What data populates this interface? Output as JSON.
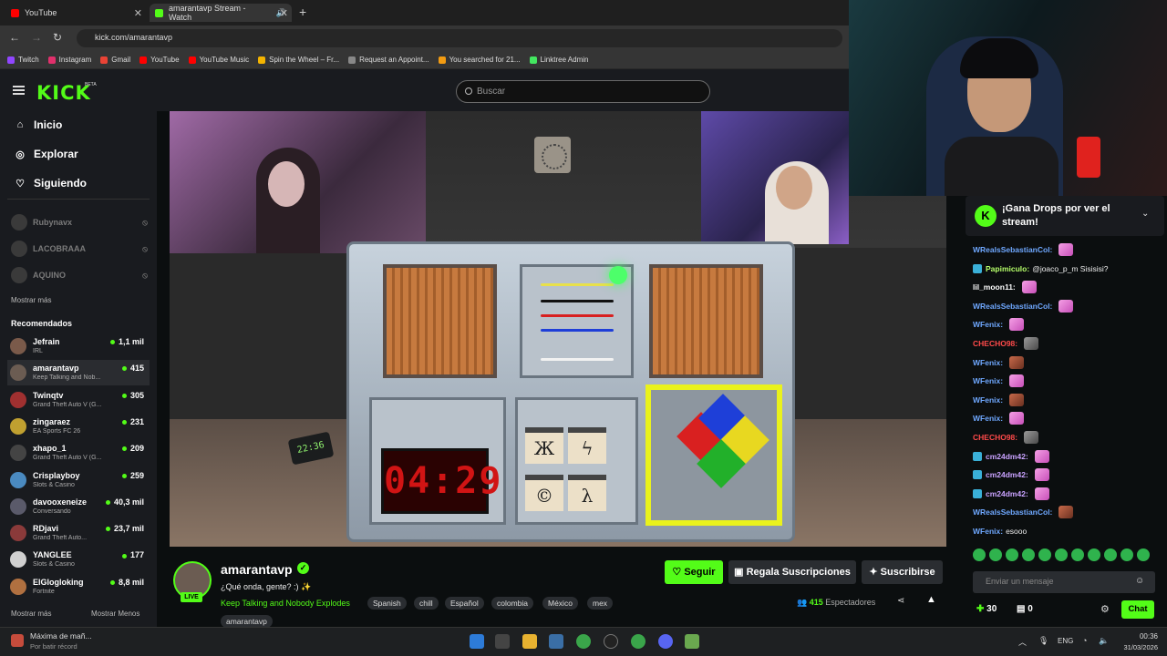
{
  "browser": {
    "tabs": [
      {
        "label": "YouTube",
        "color": "#ff0000"
      },
      {
        "label": "amarantavp Stream - Watch",
        "color": "#53fc18"
      }
    ],
    "url": "kick.com/amarantavp",
    "bookmarks": [
      {
        "label": "Twitch",
        "color": "#9146ff"
      },
      {
        "label": "Instagram",
        "color": "#e1306c"
      },
      {
        "label": "Gmail",
        "color": "#ea4335"
      },
      {
        "label": "YouTube",
        "color": "#ff0000"
      },
      {
        "label": "YouTube Music",
        "color": "#ff0000"
      },
      {
        "label": "Spin the Wheel – Fr...",
        "color": "#f4b400"
      },
      {
        "label": "Request an Appoint...",
        "color": "#888888"
      },
      {
        "label": "You searched for 21...",
        "color": "#f39c12"
      },
      {
        "label": "Linktree Admin",
        "color": "#43e660"
      }
    ]
  },
  "header": {
    "logo": "KICK",
    "beta": "BETA",
    "search_placeholder": "Buscar"
  },
  "sidebar": {
    "nav": [
      {
        "label": "Inicio",
        "icon": "home-icon"
      },
      {
        "label": "Explorar",
        "icon": "compass-icon"
      },
      {
        "label": "Siguiendo",
        "icon": "heart-icon"
      }
    ],
    "offline": [
      "Rubynavx",
      "LACOBRAAA",
      "AQUINO"
    ],
    "show_more": "Mostrar más",
    "recommended_title": "Recomendados",
    "recommended": [
      {
        "name": "Jefrain",
        "category": "IRL",
        "viewers": "1,1 mil",
        "color": "#7a5a4a"
      },
      {
        "name": "amarantavp",
        "category": "Keep Talking and Nob...",
        "viewers": "415",
        "color": "#6b5c52"
      },
      {
        "name": "Twinqtv",
        "category": "Grand Theft Auto V (G...",
        "viewers": "305",
        "color": "#a03030"
      },
      {
        "name": "zingaraez",
        "category": "EA Sports FC 26",
        "viewers": "231",
        "color": "#c0a030"
      },
      {
        "name": "xhapo_1",
        "category": "Grand Theft Auto V (G...",
        "viewers": "209",
        "color": "#444444"
      },
      {
        "name": "Crisplayboy",
        "category": "Slots & Casino",
        "viewers": "259",
        "color": "#4a8ac0"
      },
      {
        "name": "davooxeneize",
        "category": "Conversando",
        "viewers": "40,3 mil",
        "color": "#5a5a6a"
      },
      {
        "name": "RDjavi",
        "category": "Grand Theft Auto...",
        "viewers": "23,7 mil",
        "color": "#8a3a3a"
      },
      {
        "name": "YANGLEE",
        "category": "Slots & Casino",
        "viewers": "177",
        "color": "#d0d0d0"
      },
      {
        "name": "ElGlogloking",
        "category": "Fortnite",
        "viewers": "8,8 mil",
        "color": "#b07040"
      }
    ],
    "show_more_bottom": "Mostrar más",
    "show_less": "Mostrar Menos"
  },
  "game": {
    "timer": "04:29",
    "clock": "22:36",
    "symbols": [
      "Ж",
      "ϟ",
      "©",
      "λ"
    ]
  },
  "stream": {
    "channel": "amarantavp",
    "live": "LIVE",
    "title": "¿Qué onda, gente? :) ✨",
    "game": "Keep Talking and Nobody Explodes",
    "tags": [
      "Spanish",
      "chill",
      "Español",
      "colombia",
      "México",
      "mex",
      "amarantavp"
    ],
    "follow": "Seguir",
    "gift": "Regala Suscripciones",
    "subscribe": "Suscribirse",
    "viewers": "415",
    "viewers_label": "Espectadores"
  },
  "chat": {
    "drops_text": "¡Gana Drops por ver el stream!",
    "messages": [
      {
        "user": "WRealsSebastianCol:",
        "text": "",
        "color": "#6fa8ff",
        "emote": "hand",
        "badge": false
      },
      {
        "user": "Papimiculo:",
        "text": "@joaco_p_m Sisisisi?",
        "color": "#b6ff6a",
        "emote": "",
        "badge": true
      },
      {
        "user": "lil_moon11:",
        "text": "",
        "color": "#ffffff",
        "emote": "hand",
        "badge": false
      },
      {
        "user": "WRealsSebastianCol:",
        "text": "",
        "color": "#6fa8ff",
        "emote": "hand",
        "badge": false
      },
      {
        "user": "WFenix:",
        "text": "",
        "color": "#6fa8ff",
        "emote": "hand",
        "badge": false
      },
      {
        "user": "CHECHO98:",
        "text": "",
        "color": "#ff4a4a",
        "emote": "cat",
        "badge": false
      },
      {
        "user": "WFenix:",
        "text": "",
        "color": "#6fa8ff",
        "emote": "face",
        "badge": false
      },
      {
        "user": "WFenix:",
        "text": "",
        "color": "#6fa8ff",
        "emote": "hand",
        "badge": false
      },
      {
        "user": "WFenix:",
        "text": "",
        "color": "#6fa8ff",
        "emote": "face",
        "badge": false
      },
      {
        "user": "WFenix:",
        "text": "",
        "color": "#6fa8ff",
        "emote": "hand",
        "badge": false
      },
      {
        "user": "CHECHO98:",
        "text": "",
        "color": "#ff4a4a",
        "emote": "cat",
        "badge": false
      },
      {
        "user": "cm24dm42:",
        "text": "",
        "color": "#c9a2ff",
        "emote": "hand",
        "badge": true
      },
      {
        "user": "cm24dm42:",
        "text": "",
        "color": "#c9a2ff",
        "emote": "hand",
        "badge": true
      },
      {
        "user": "cm24dm42:",
        "text": "",
        "color": "#c9a2ff",
        "emote": "hand",
        "badge": true
      },
      {
        "user": "WRealsSebastianCol:",
        "text": "",
        "color": "#6fa8ff",
        "emote": "face",
        "badge": false
      },
      {
        "user": "WFenix:",
        "text": "esooo",
        "color": "#6fa8ff",
        "emote": "",
        "badge": false
      }
    ],
    "input_placeholder": "Enviar un mensaje",
    "points": "30",
    "points2": "0",
    "send": "Chat"
  },
  "taskbar": {
    "weather_title": "Máxima de mañ...",
    "weather_sub": "Por batir récord",
    "lang": "ENG",
    "time": "00:36",
    "date": "31/03/2026"
  }
}
